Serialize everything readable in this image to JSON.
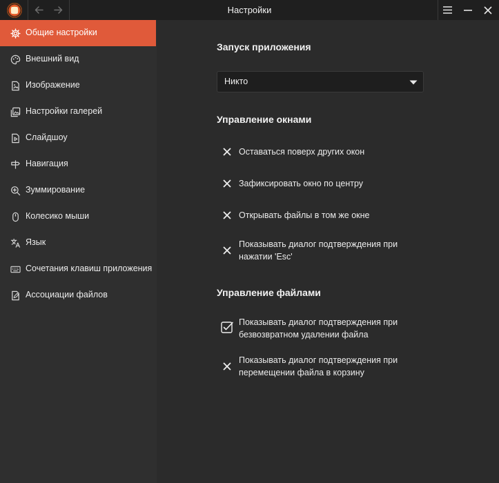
{
  "window": {
    "title": "Настройки"
  },
  "sidebar": {
    "items": [
      {
        "label": "Общие настройки",
        "icon": "gear-icon",
        "active": true
      },
      {
        "label": "Внешний вид",
        "icon": "palette-icon",
        "active": false
      },
      {
        "label": "Изображение",
        "icon": "image-file-icon",
        "active": false
      },
      {
        "label": "Настройки галерей",
        "icon": "gallery-icon",
        "active": false
      },
      {
        "label": "Слайдшоу",
        "icon": "slideshow-icon",
        "active": false
      },
      {
        "label": "Навигация",
        "icon": "signpost-icon",
        "active": false
      },
      {
        "label": "Зуммирование",
        "icon": "zoom-in-icon",
        "active": false
      },
      {
        "label": "Колесико мыши",
        "icon": "mouse-icon",
        "active": false
      },
      {
        "label": "Язык",
        "icon": "translate-icon",
        "active": false
      },
      {
        "label": "Сочетания клавиш приложения",
        "icon": "keyboard-icon",
        "active": false
      },
      {
        "label": "Ассоциации файлов",
        "icon": "file-association-icon",
        "active": false
      }
    ]
  },
  "main": {
    "startup": {
      "title": "Запуск приложения",
      "dropdown_value": "Никто"
    },
    "window_management": {
      "title": "Управление окнами",
      "options": [
        {
          "label": "Оставаться поверх других окон",
          "checked": false
        },
        {
          "label": "Зафиксировать окно по центру",
          "checked": false
        },
        {
          "label": "Открывать файлы в том же окне",
          "checked": false
        },
        {
          "label": "Показывать диалог подтверждения при нажатии 'Esc'",
          "checked": false
        }
      ]
    },
    "file_management": {
      "title": "Управление файлами",
      "options": [
        {
          "label": "Показывать диалог подтверждения при безвозвратном удалении файла",
          "checked": true
        },
        {
          "label": "Показывать диалог подтверждения при перемещении файла в корзину",
          "checked": false
        }
      ]
    }
  },
  "colors": {
    "accent": "#e05a3a",
    "titlebar": "#1f1f1f",
    "sidebar": "#2f2f2f",
    "content": "#2b2b2b"
  }
}
